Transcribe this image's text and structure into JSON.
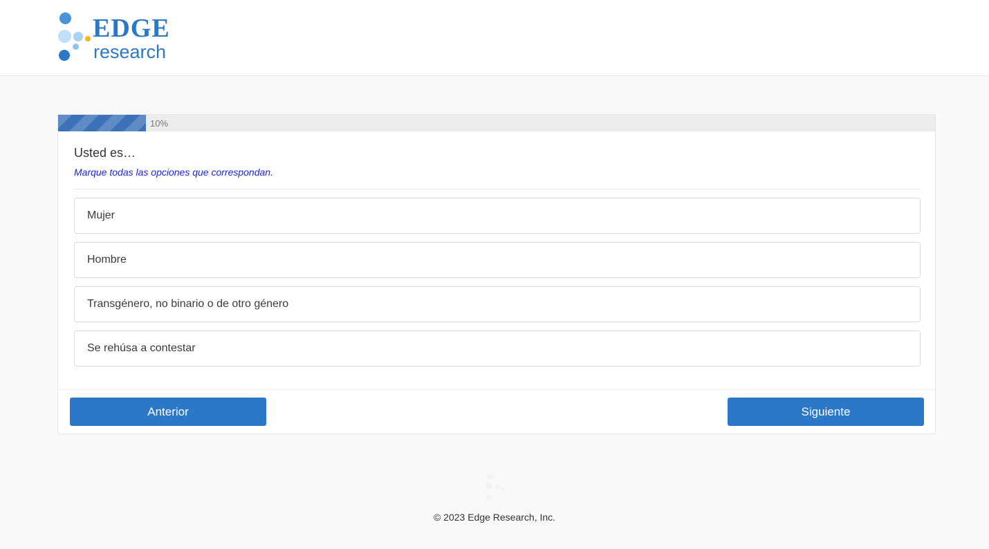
{
  "header": {
    "logo": {
      "brand": "EDGE",
      "subtitle": "research"
    }
  },
  "progress": {
    "value": 0.1,
    "label": "10%"
  },
  "question": {
    "title": "Usted es…",
    "instructions": "Marque todas las opciones que correspondan.",
    "options": [
      {
        "label": "Mujer"
      },
      {
        "label": "Hombre"
      },
      {
        "label": "Transgénero, no binario o de otro género"
      },
      {
        "label": "Se rehúsa a contestar"
      }
    ]
  },
  "navigation": {
    "previous_label": "Anterior",
    "next_label": "Siguiente"
  },
  "footer": {
    "copyright": "© 2023 Edge Research, Inc."
  },
  "colors": {
    "brand_blue": "#2b78c5",
    "button_blue": "#2c78c8",
    "progress_fill": "#3c73b8",
    "instructions_text": "#1a23d8",
    "logo_accent_yellow": "#f2b824",
    "logo_light_blue": "#bfe0f8"
  }
}
